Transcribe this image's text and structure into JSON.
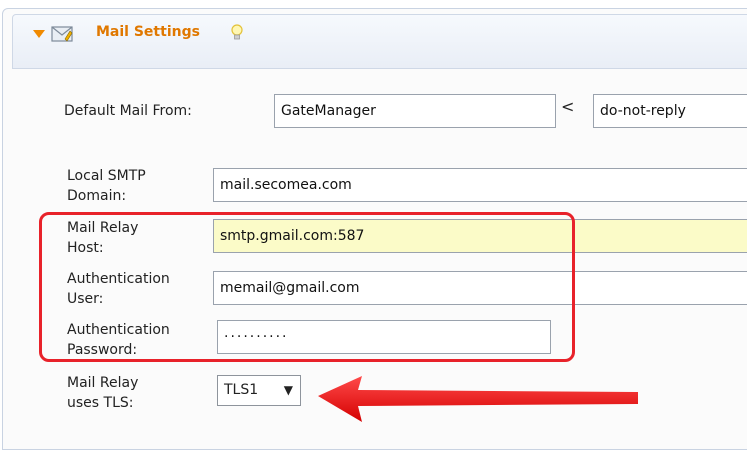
{
  "panel": {
    "title": "Mail Settings",
    "icons": [
      "collapse-arrow-icon",
      "mail-icon",
      "lightbulb-icon"
    ]
  },
  "form": {
    "default_mail_from": {
      "label": "Default Mail From:",
      "name_value": "GateManager",
      "separator": "<",
      "address_value": "do-not-reply"
    },
    "local_smtp_domain": {
      "label": "Local SMTP\nDomain:",
      "value": "mail.secomea.com"
    },
    "mail_relay_host": {
      "label": "Mail Relay\nHost:",
      "value": "smtp.gmail.com:587"
    },
    "authentication_user": {
      "label": "Authentication\nUser:",
      "value": "memail@gmail.com"
    },
    "authentication_password": {
      "label": "Authentication\nPassword:",
      "value": "··········"
    },
    "mail_relay_tls": {
      "label": "Mail Relay\nuses TLS:",
      "selected": "TLS1"
    }
  },
  "colors": {
    "title": "#e07800",
    "highlight": "#e8222a",
    "relay_host_bg": "#fbfbc8"
  }
}
